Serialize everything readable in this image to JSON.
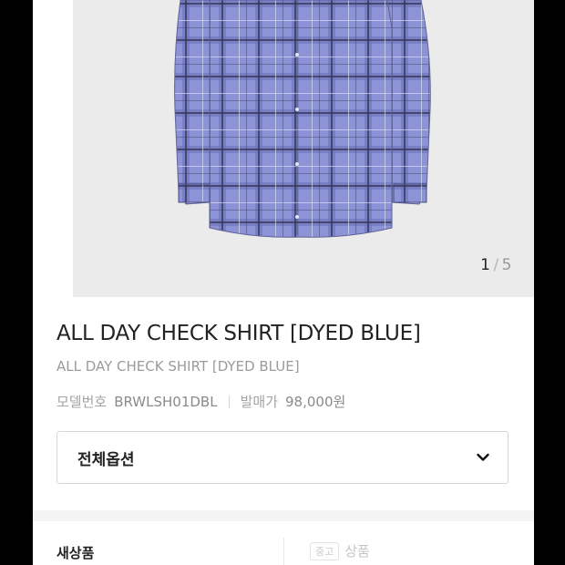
{
  "gallery": {
    "current_index": "1",
    "separator": "/",
    "total": "5",
    "image_alt": "product-photo"
  },
  "product": {
    "title": "ALL DAY CHECK SHIRT [DYED BLUE]",
    "subtitle": "ALL DAY CHECK SHIRT [DYED BLUE]",
    "model_label": "모델번호",
    "model_value": "BRWLSH01DBL",
    "price_label": "발매가",
    "price_value": "98,000원"
  },
  "options": {
    "selected": "전체옵션"
  },
  "condition": {
    "new_label": "새상품",
    "used_badge": "중고",
    "used_label": "상품"
  },
  "colors": {
    "shirt": "#8c93d6",
    "accent_text": "#222222",
    "muted_text": "#9b9b9b",
    "photo_bg": "#ebebeb"
  }
}
